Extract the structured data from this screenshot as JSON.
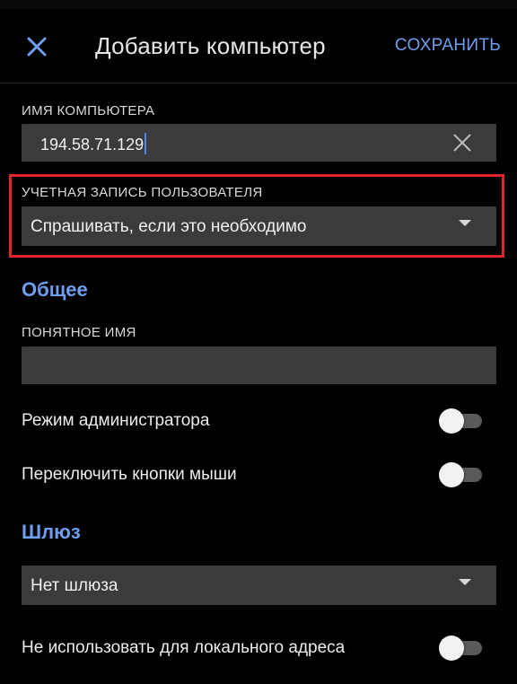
{
  "header": {
    "title": "Добавить компьютер",
    "save_label": "СОХРАНИТЬ",
    "close_icon": "close-icon"
  },
  "computer_name": {
    "label": "ИМЯ КОМПЬЮТЕРА",
    "value": "194.58.71.129",
    "clear_icon": "clear-icon"
  },
  "user_account": {
    "label": "УЧЕТНАЯ ЗАПИСЬ ПОЛЬЗОВАТЕЛЯ",
    "selected": "Спрашивать, если это необходимо",
    "highlight_color": "#e0262b"
  },
  "general": {
    "title": "Общее",
    "friendly_name_label": "ПОНЯТНОЕ ИМЯ",
    "friendly_name_value": "",
    "admin_mode_label": "Режим администратора",
    "admin_mode_on": false,
    "swap_mouse_label": "Переключить кнопки мыши",
    "swap_mouse_on": false
  },
  "gateway": {
    "title": "Шлюз",
    "selected": "Нет шлюза",
    "bypass_local_label": "Не использовать для локального адреса",
    "bypass_local_on": false
  },
  "colors": {
    "accent": "#6f9ef0",
    "background": "#000000",
    "field": "#3b3b3b"
  }
}
